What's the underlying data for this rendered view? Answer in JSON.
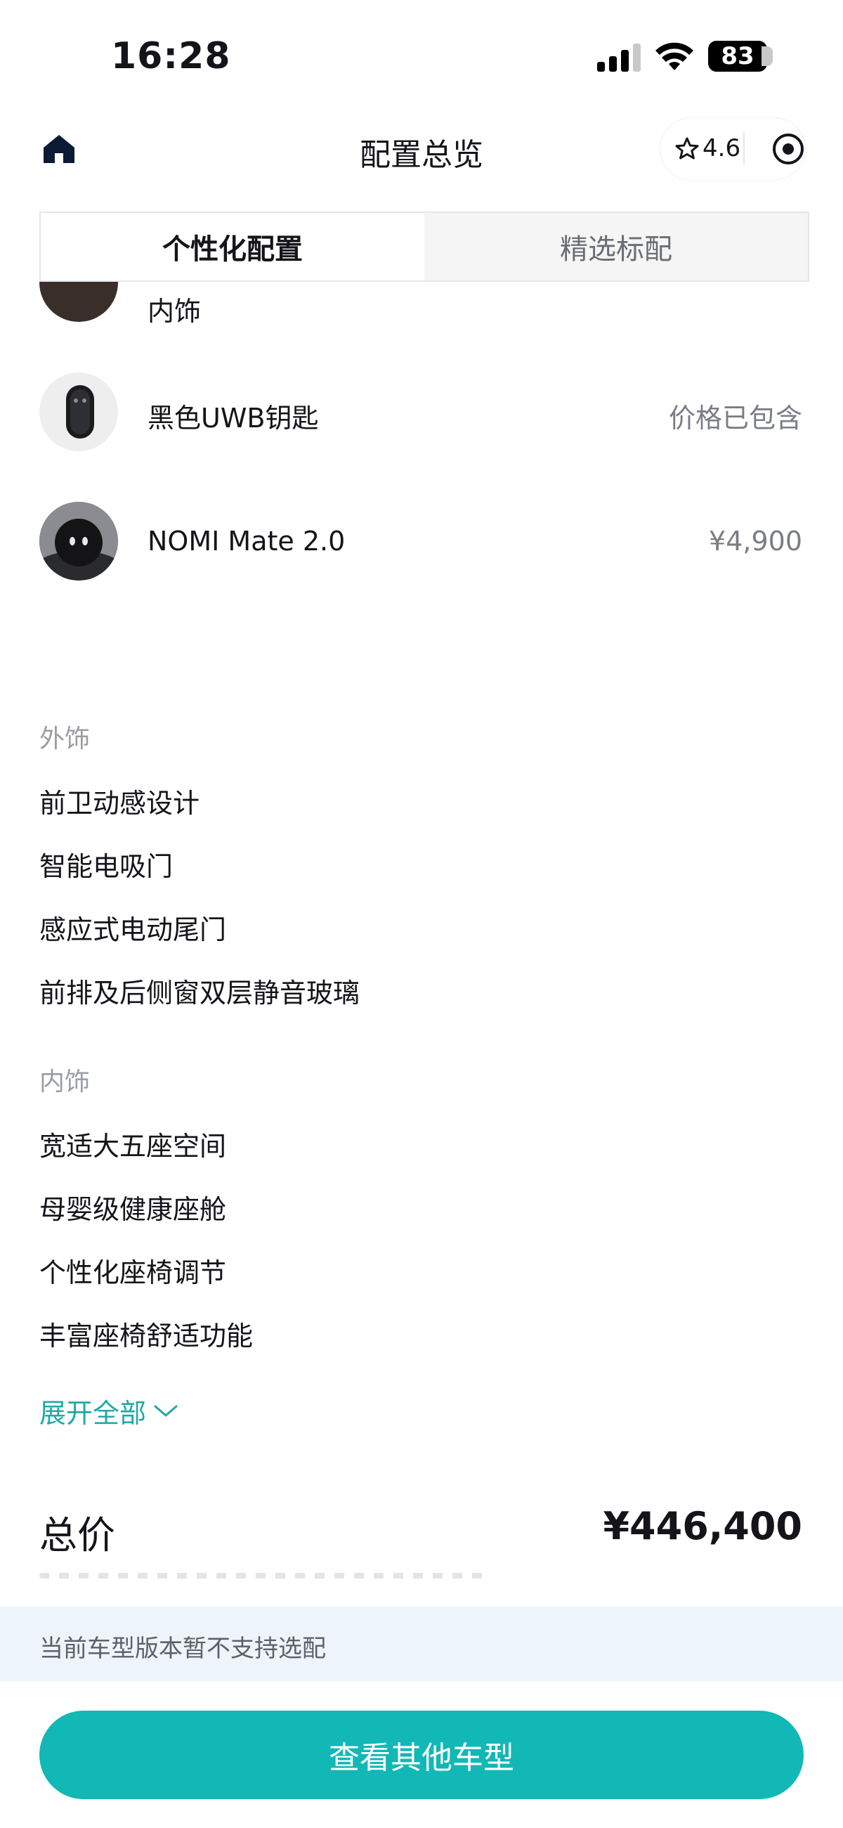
{
  "status_bar": {
    "time": "16:28",
    "battery": "83"
  },
  "nav": {
    "title": "配置总览",
    "rating": "4.6"
  },
  "tabs": [
    {
      "label": "个性化配置",
      "active": true
    },
    {
      "label": "精选标配",
      "active": false
    }
  ],
  "partial_row": {
    "label": "内饰"
  },
  "options": [
    {
      "label": "黑色UWB钥匙",
      "price": "价格已包含"
    },
    {
      "label": "NOMI Mate 2.0",
      "price": "¥4,900"
    }
  ],
  "sections": [
    {
      "title": "外饰",
      "items": [
        "前卫动感设计",
        "智能电吸门",
        "感应式电动尾门",
        "前排及后侧窗双层静音玻璃"
      ]
    },
    {
      "title": "内饰",
      "items": [
        "宽适大五座空间",
        "母婴级健康座舱",
        "个性化座椅调节",
        "丰富座椅舒适功能"
      ]
    }
  ],
  "expand_label": "展开全部",
  "total": {
    "label": "总价",
    "value": "¥446,400"
  },
  "notice": "当前车型版本暂不支持选配",
  "cta_label": "查看其他车型",
  "colors": {
    "accent": "#11b8b5",
    "link": "#1fa9a6",
    "notice_bg": "#eef4fb"
  }
}
